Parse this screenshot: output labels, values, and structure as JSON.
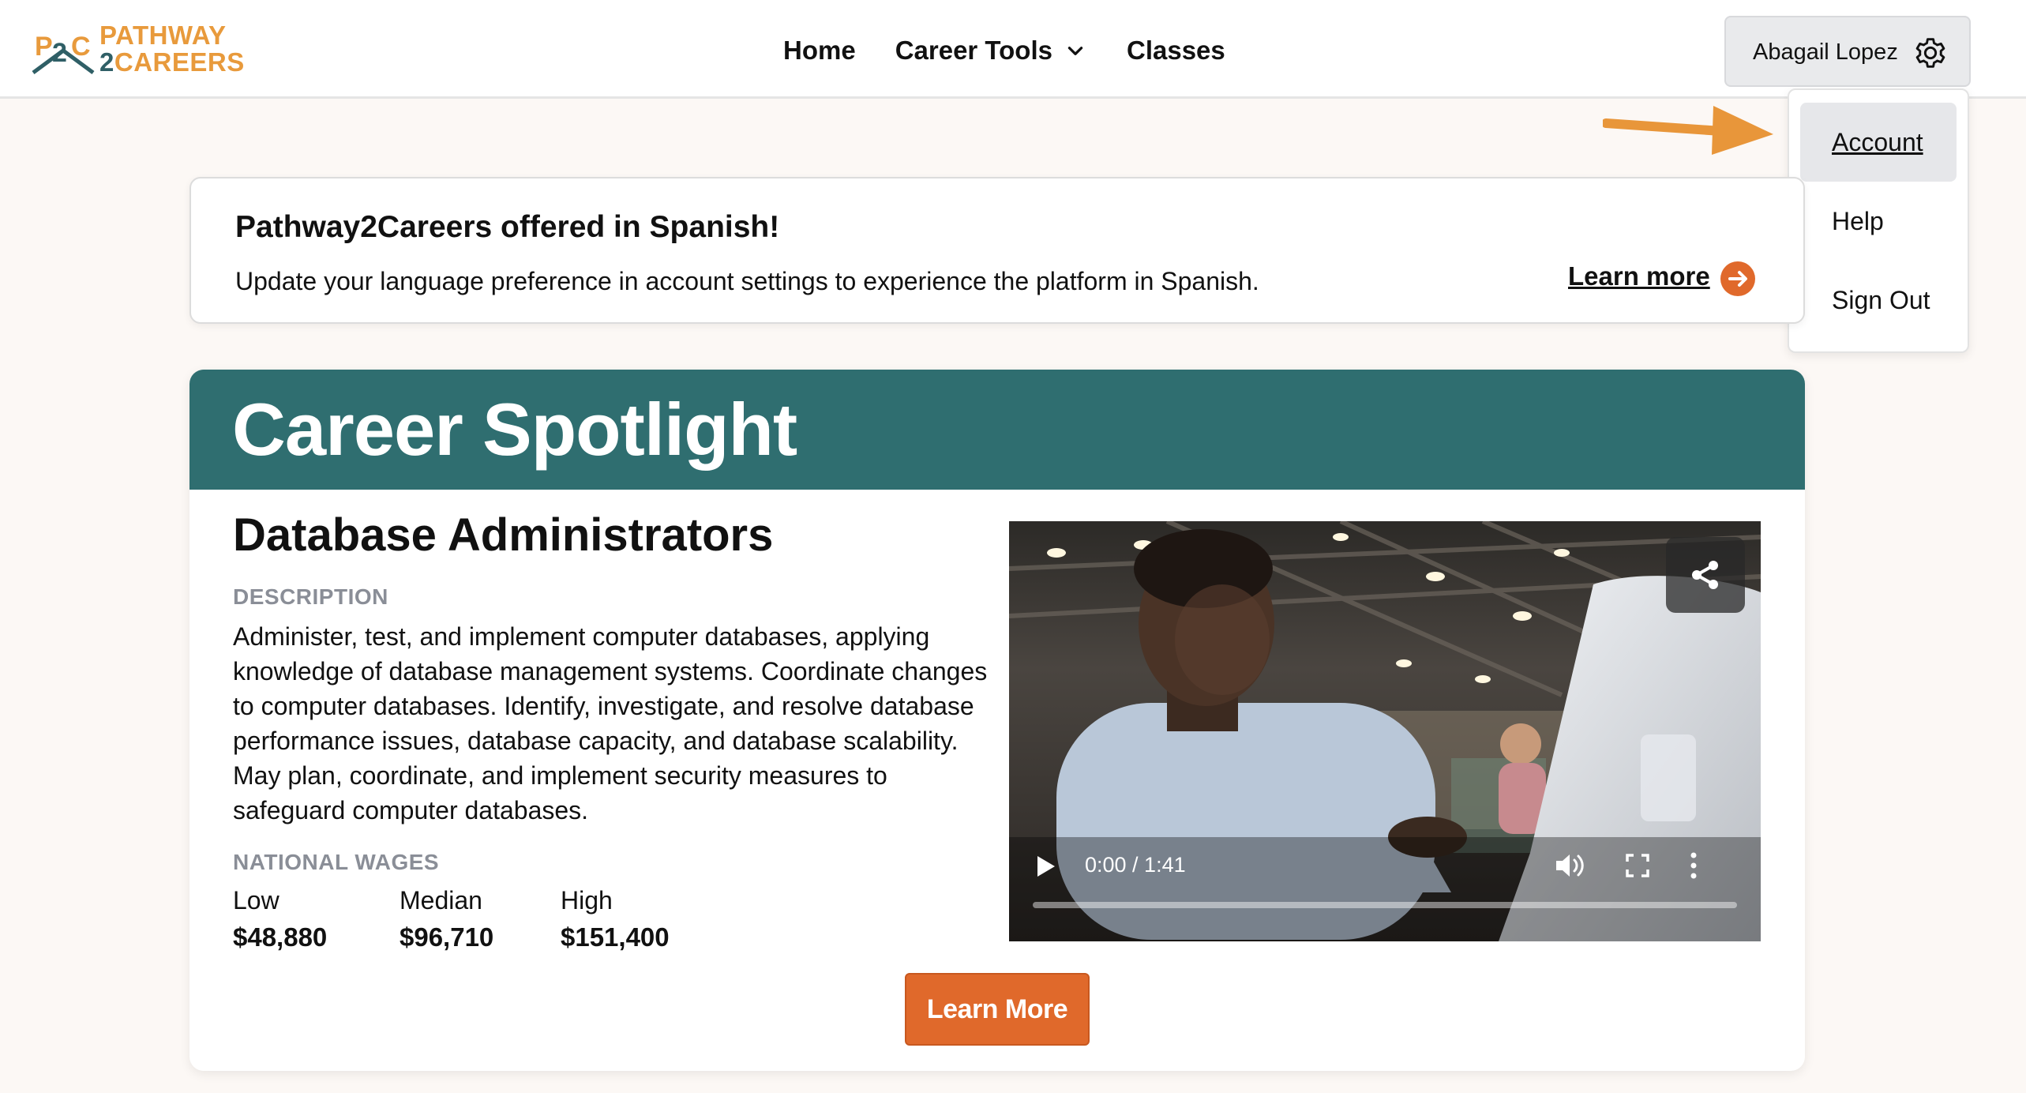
{
  "brand": {
    "logo_mark": "P2C",
    "line1": "PATHWAY",
    "line2_num": "2",
    "line2_word": "CAREERS"
  },
  "nav": {
    "home": "Home",
    "career_tools": "Career Tools",
    "classes": "Classes"
  },
  "user": {
    "name": "Abagail Lopez",
    "icon": "gear-icon"
  },
  "dropdown": {
    "items": [
      {
        "label": "Account"
      },
      {
        "label": "Help"
      },
      {
        "label": "Sign Out"
      }
    ]
  },
  "banner": {
    "title": "Pathway2Careers offered in Spanish!",
    "text": "Update your language preference in account settings to experience the platform in Spanish.",
    "link": "Learn more"
  },
  "spotlight": {
    "heading": "Career Spotlight",
    "job_title": "Database Administrators",
    "description_label": "DESCRIPTION",
    "description": "Administer, test, and implement computer databases, applying knowledge of database management systems. Coordinate changes to computer databases. Identify, investigate, and resolve database performance issues, database capacity, and database scalability. May plan, coordinate, and implement security measures to safeguard computer databases.",
    "wages_label": "NATIONAL WAGES",
    "wages": {
      "low_label": "Low",
      "low": "$48,880",
      "median_label": "Median",
      "median": "$96,710",
      "high_label": "High",
      "high": "$151,400"
    },
    "video": {
      "time": "0:00 / 1:41",
      "progress": 0
    },
    "button": "Learn More"
  },
  "colors": {
    "accent": "#e0692b",
    "header_teal": "#2f6e70",
    "logo_orange": "#e89a3c",
    "annotation_arrow": "#e8963a"
  }
}
